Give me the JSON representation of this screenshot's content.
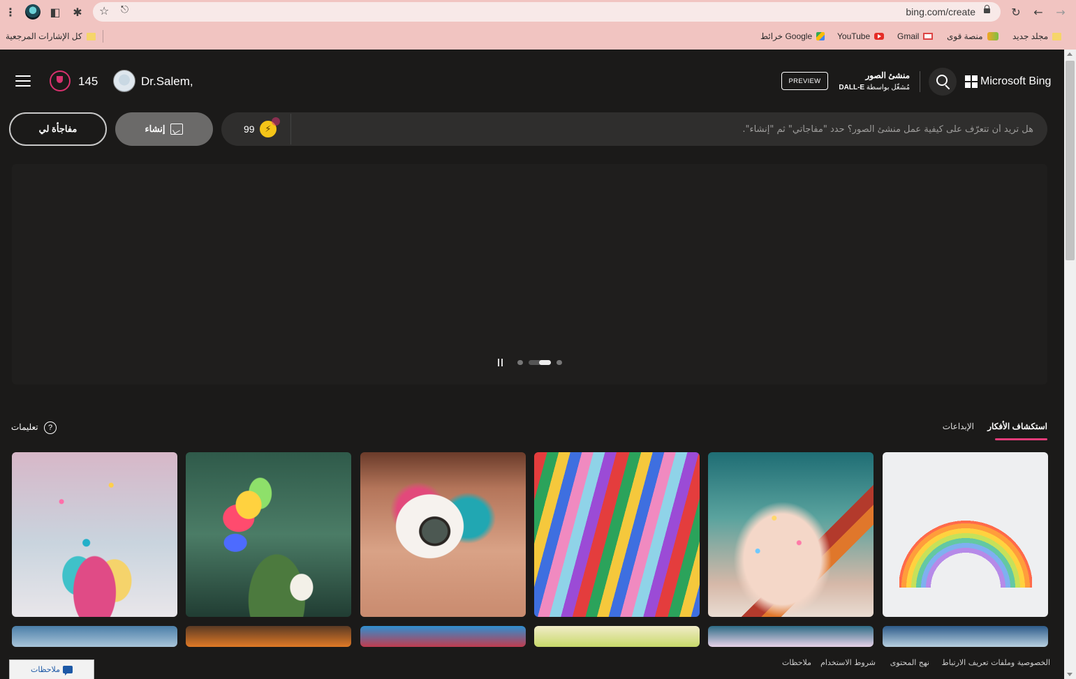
{
  "browser": {
    "url": "bing.com/create",
    "bookmarks": [
      {
        "label": "مجلد جديد",
        "icon": "folder-icon"
      },
      {
        "label": "منصة قوى",
        "icon": "qiwa-icon"
      },
      {
        "label": "Gmail",
        "icon": "gmail-icon"
      },
      {
        "label": "YouTube",
        "icon": "youtube-icon"
      },
      {
        "label": "خرائط Google",
        "icon": "maps-icon"
      }
    ],
    "all_bookmarks": "كل الإشارات المرجعية"
  },
  "header": {
    "rewards_count": "145",
    "username": "Dr.Salem,",
    "brand": "Microsoft Bing",
    "creator_title": "منشئ الصور",
    "creator_sub_prefix": "مُشغّل بواسطة",
    "creator_sub_model": "DALL-E",
    "preview_label": "PREVIEW"
  },
  "prompt": {
    "placeholder": "هل تريد أن تتعرّف على كيفية عمل منشئ الصور؟ حدد \"مفاجأتي\" ثم \"إنشاء\".",
    "boosts": "99",
    "create_label": "إنشاء",
    "surprise_label": "مفاجأة لي"
  },
  "carousel": {
    "slides": 3,
    "active_slide": 2
  },
  "tabs": {
    "explore_label": "استكشاف الأفكار",
    "creations_label": "الإبداعات",
    "help_label": "تعليمات"
  },
  "gallery": {
    "items": [
      {
        "subject": "paint-splash"
      },
      {
        "subject": "rainbow-butterfly"
      },
      {
        "subject": "colorful-eye-makeup"
      },
      {
        "subject": "colorful-ribbons"
      },
      {
        "subject": "glitter-pencil"
      },
      {
        "subject": "paper-rainbow"
      }
    ]
  },
  "footer": {
    "links": [
      "الخصوصية وملفات تعريف الارتباط",
      "نهج المحتوى",
      "شروط الاستخدام",
      "ملاحظات"
    ],
    "feedback_label": "ملاحظات"
  },
  "colors": {
    "accent_pink": "#e23c79",
    "background": "#1b1a19",
    "browser_chrome": "#f1c4c1"
  }
}
